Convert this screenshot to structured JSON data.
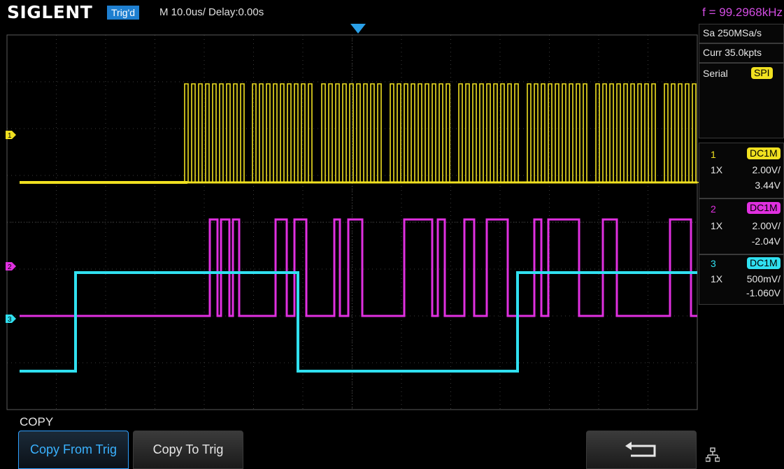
{
  "header": {
    "brand": "SIGLENT",
    "trigger_status": "Trig'd",
    "timebase": "M 10.0us/  Delay:0.00s",
    "frequency": "f = 99.2968kHz"
  },
  "acquisition": {
    "sample_rate": "Sa 250MSa/s",
    "memory_depth": "Curr 35.0kpts"
  },
  "decode": {
    "label": "Serial",
    "protocol": "SPI",
    "protocol_color": "#f0e020"
  },
  "channels": [
    {
      "number": "1",
      "coupling": "DC1M",
      "probe": "1X",
      "scale": "2.00V/",
      "offset": "3.44V",
      "color": "#f0e020"
    },
    {
      "number": "2",
      "coupling": "DC1M",
      "probe": "1X",
      "scale": "2.00V/",
      "offset": "-2.04V",
      "color": "#e030e0"
    },
    {
      "number": "3",
      "coupling": "DC1M",
      "probe": "1X",
      "scale": "500mV/",
      "offset": "-1.060V",
      "color": "#30e0f0"
    }
  ],
  "menu": {
    "title": "COPY",
    "copy_from_trig": "Copy From Trig",
    "copy_to_trig": "Copy To Trig",
    "back_icon": "return-arrow-icon",
    "network_icon": "network-icon"
  },
  "grid": {
    "on": true
  }
}
